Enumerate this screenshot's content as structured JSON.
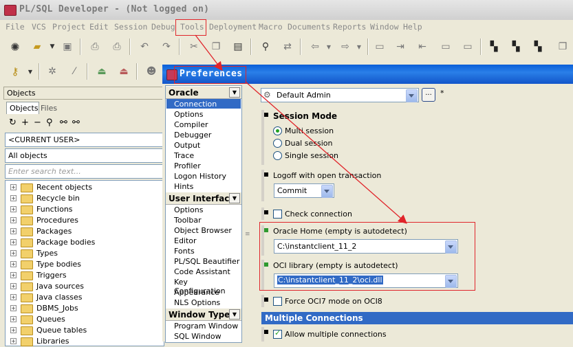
{
  "app": {
    "title": "PL/SQL Developer - (Not logged on)"
  },
  "menubar": [
    "File",
    "VCS",
    "Project",
    "Edit",
    "Session",
    "Debug",
    "Tools",
    "Deployment",
    "Macro",
    "Documents",
    "Reports",
    "Window",
    "Help"
  ],
  "objects_panel": {
    "header": "Objects",
    "tabs": [
      "Objects",
      "Files"
    ],
    "user_select": "<CURRENT USER>",
    "filter_select": "All objects",
    "search_placeholder": "Enter search text...",
    "tree": [
      "Recent objects",
      "Recycle bin",
      "Functions",
      "Procedures",
      "Packages",
      "Package bodies",
      "Types",
      "Type bodies",
      "Triggers",
      "Java sources",
      "Java classes",
      "DBMS_Jobs",
      "Queues",
      "Queue tables",
      "Libraries"
    ]
  },
  "dialog": {
    "title": "Preferences",
    "nav": {
      "groups": [
        {
          "label": "Oracle",
          "items": [
            "Connection",
            "Options",
            "Compiler",
            "Debugger",
            "Output",
            "Trace",
            "Profiler",
            "Logon History",
            "Hints"
          ]
        },
        {
          "label": "User Interface",
          "items": [
            "Options",
            "Toolbar",
            "Object Browser",
            "Editor",
            "Fonts",
            "PL/SQL Beautifier",
            "Code Assistant",
            "Key Configuration",
            "Appearance",
            "NLS Options"
          ]
        },
        {
          "label": "Window Types",
          "items": [
            "Program Window",
            "SQL Window"
          ]
        }
      ],
      "selected": "Connection"
    },
    "profile": {
      "value": "Default Admin",
      "more_button": "...",
      "modified_marker": "*"
    },
    "session_mode": {
      "label": "Session Mode",
      "options": [
        "Multi session",
        "Dual session",
        "Single session"
      ],
      "selected": "Multi session"
    },
    "logoff": {
      "label": "Logoff with open transaction",
      "value": "Commit"
    },
    "check_connection": {
      "label": "Check connection",
      "checked": false
    },
    "oracle_home": {
      "label": "Oracle Home (empty is autodetect)",
      "value": "C:\\instantclient_11_2"
    },
    "oci_library": {
      "label": "OCI library (empty is autodetect)",
      "value": "C:\\instantclient_11_2\\oci.dll"
    },
    "force_oci7": {
      "label": "Force OCI7 mode on OCI8",
      "checked": false
    },
    "multiple_connections": {
      "header": "Multiple Connections",
      "allow_label": "Allow multiple connections",
      "allow_checked": true
    }
  },
  "colors": {
    "annotation_red": "#e0242a",
    "selection_blue": "#316ac5",
    "title_blue": "#0a5fd8"
  }
}
